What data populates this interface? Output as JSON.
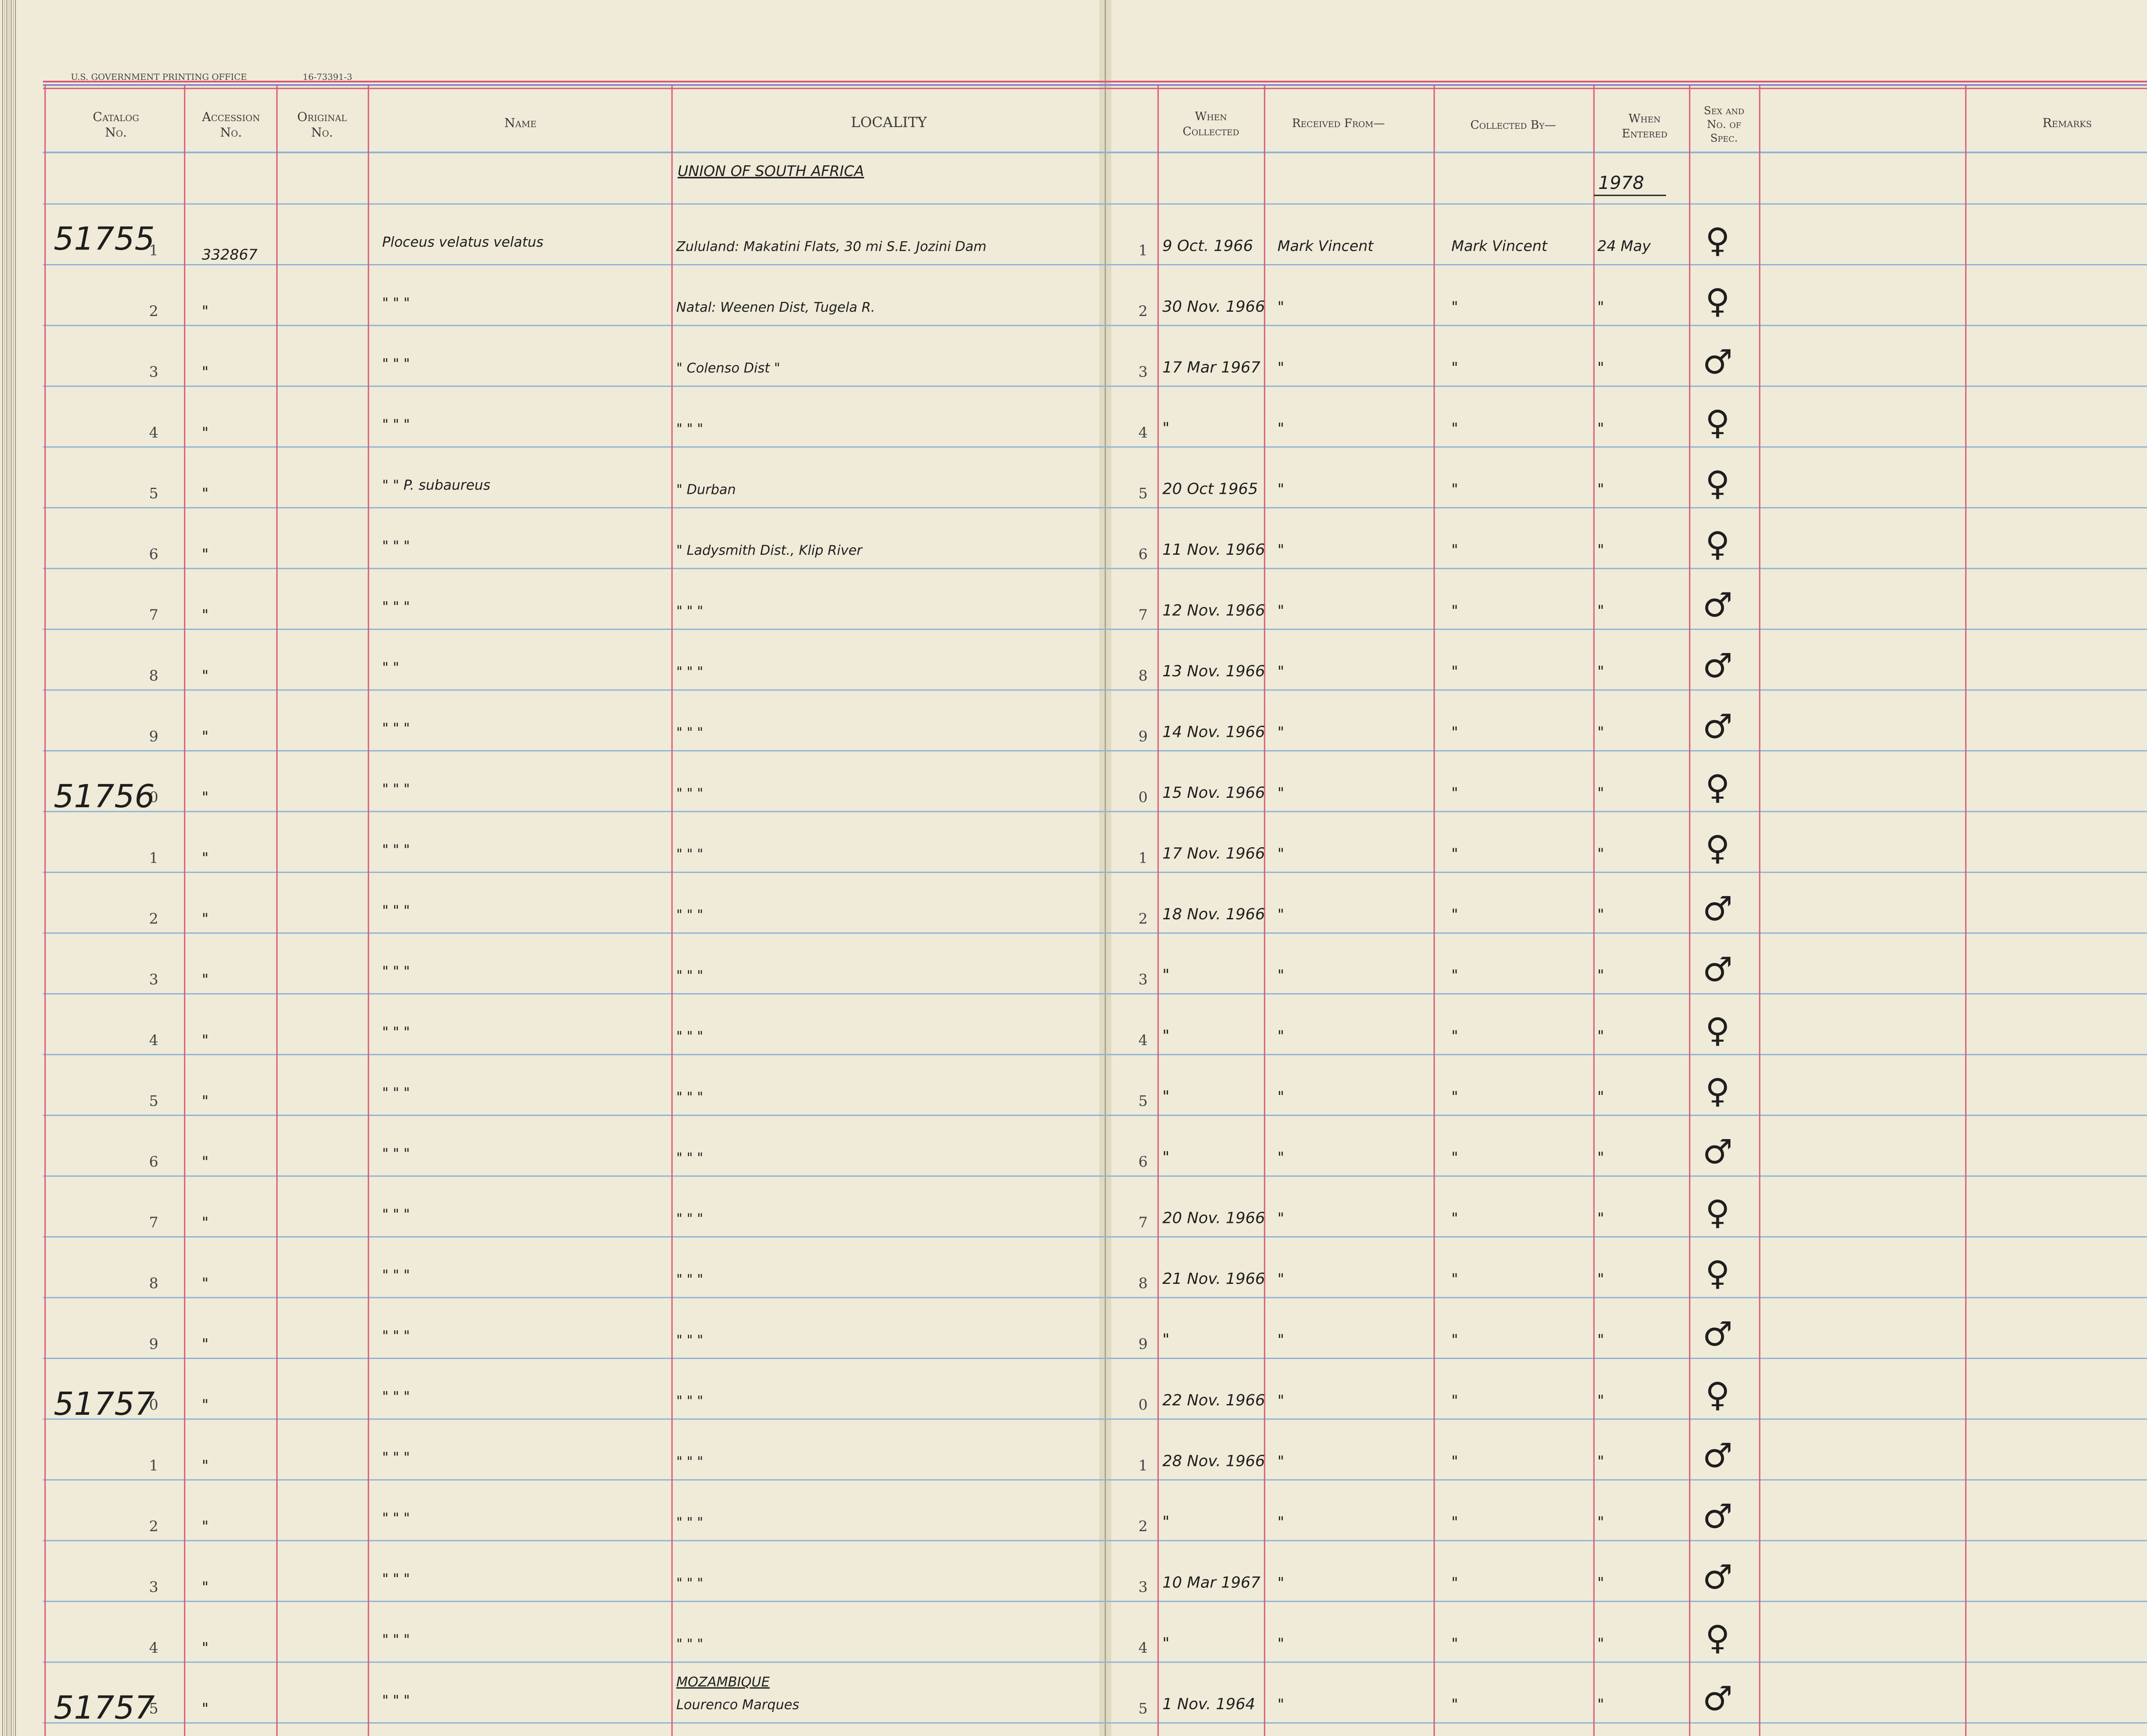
{
  "printer_line": [
    "U.S. GOVERNMENT PRINTING OFFICE",
    "16-73391-3"
  ],
  "headers": {
    "catalog": [
      "Catalog",
      "No."
    ],
    "accession": [
      "Accession",
      "No."
    ],
    "original": [
      "Original",
      "No."
    ],
    "name": "Name",
    "locality": "LOCALITY",
    "when_collected": [
      "When",
      "Collected"
    ],
    "received_from": "Received From—",
    "collected_by": "Collected By—",
    "when_entered": [
      "When",
      "Entered"
    ],
    "sex": [
      "Sex and",
      "No. of",
      "Spec."
    ],
    "remarks": "Remarks"
  },
  "header_notes": {
    "locality_region": "UNION OF SOUTH AFRICA",
    "entered_year": "1978"
  },
  "rows": [
    {
      "row": "1",
      "catalog": "51755",
      "accession": "332867",
      "name": "Ploceus velatus velatus",
      "locality": "Zululand: Makatini Flats, 30 mi S.E. Jozini Dam",
      "collected": "9 Oct. 1966",
      "received": "Mark Vincent",
      "collector": "Mark Vincent",
      "entered": "24 May",
      "sex": "♀"
    },
    {
      "row": "2",
      "accession": "\"",
      "name": "\"   \"   \"",
      "locality": "Natal: Weenen Dist, Tugela R.",
      "collected": "30 Nov. 1966",
      "received": "\"",
      "collector": "\"",
      "entered": "\"",
      "sex": "♀"
    },
    {
      "row": "3",
      "accession": "\"",
      "name": "\"   \"   \"",
      "locality": "\"   Colenso Dist   \"",
      "collected": "17 Mar 1967",
      "received": "\"",
      "collector": "\"",
      "entered": "\"",
      "sex": "♂"
    },
    {
      "row": "4",
      "accession": "\"",
      "name": "\"   \"   \"",
      "locality": "\"   \"   \"",
      "collected": "\"",
      "received": "\"",
      "collector": "\"",
      "entered": "\"",
      "sex": "♀"
    },
    {
      "row": "5",
      "accession": "\"",
      "name": "\"   \" P. subaureus",
      "locality": "\"   Durban",
      "collected": "20 Oct 1965",
      "received": "\"",
      "collector": "\"",
      "entered": "\"",
      "sex": "♀"
    },
    {
      "row": "6",
      "accession": "\"",
      "name": "\"   \"   \"",
      "locality": "\"   Ladysmith Dist., Klip River",
      "collected": "11 Nov. 1966",
      "received": "\"",
      "collector": "\"",
      "entered": "\"",
      "sex": "♀"
    },
    {
      "row": "7",
      "accession": "\"",
      "name": "\"   \"   \"",
      "locality": "\"   \"   \"",
      "collected": "12 Nov. 1966",
      "received": "\"",
      "collector": "\"",
      "entered": "\"",
      "sex": "♂"
    },
    {
      "row": "8",
      "accession": "\"",
      "name": "\"   \"",
      "locality": "\"   \"   \"",
      "collected": "13 Nov. 1966",
      "received": "\"",
      "collector": "\"",
      "entered": "\"",
      "sex": "♂"
    },
    {
      "row": "9",
      "accession": "\"",
      "name": "\"   \"   \"",
      "locality": "\"   \"   \"",
      "collected": "14 Nov. 1966",
      "received": "\"",
      "collector": "\"",
      "entered": "\"",
      "sex": "♂"
    },
    {
      "row": "0",
      "catalog": "51756",
      "accession": "\"",
      "name": "\"   \"   \"",
      "locality": "\"   \"   \"",
      "collected": "15 Nov. 1966",
      "received": "\"",
      "collector": "\"",
      "entered": "\"",
      "sex": "♀"
    },
    {
      "row": "1",
      "accession": "\"",
      "name": "\"   \"   \"",
      "locality": "\"   \"   \"",
      "collected": "17 Nov. 1966",
      "received": "\"",
      "collector": "\"",
      "entered": "\"",
      "sex": "♀"
    },
    {
      "row": "2",
      "accession": "\"",
      "name": "\"   \"   \"",
      "locality": "\"   \"   \"",
      "collected": "18 Nov. 1966",
      "received": "\"",
      "collector": "\"",
      "entered": "\"",
      "sex": "♂"
    },
    {
      "row": "3",
      "accession": "\"",
      "name": "\"   \"   \"",
      "locality": "\"   \"   \"",
      "collected": "\"",
      "received": "\"",
      "collector": "\"",
      "entered": "\"",
      "sex": "♂"
    },
    {
      "row": "4",
      "accession": "\"",
      "name": "\"   \"   \"",
      "locality": "\"   \"   \"",
      "collected": "\"",
      "received": "\"",
      "collector": "\"",
      "entered": "\"",
      "sex": "♀"
    },
    {
      "row": "5",
      "accession": "\"",
      "name": "\"   \"   \"",
      "locality": "\"   \"   \"",
      "collected": "\"",
      "received": "\"",
      "collector": "\"",
      "entered": "\"",
      "sex": "♀"
    },
    {
      "row": "6",
      "accession": "\"",
      "name": "\"   \"   \"",
      "locality": "\"   \"   \"",
      "collected": "\"",
      "received": "\"",
      "collector": "\"",
      "entered": "\"",
      "sex": "♂"
    },
    {
      "row": "7",
      "accession": "\"",
      "name": "\"   \"   \"",
      "locality": "\"   \"   \"",
      "collected": "20 Nov. 1966",
      "received": "\"",
      "collector": "\"",
      "entered": "\"",
      "sex": "♀"
    },
    {
      "row": "8",
      "accession": "\"",
      "name": "\"   \"   \"",
      "locality": "\"   \"   \"",
      "collected": "21 Nov. 1966",
      "received": "\"",
      "collector": "\"",
      "entered": "\"",
      "sex": "♀"
    },
    {
      "row": "9",
      "accession": "\"",
      "name": "\"   \"   \"",
      "locality": "\"   \"   \"",
      "collected": "\"",
      "received": "\"",
      "collector": "\"",
      "entered": "\"",
      "sex": "♂"
    },
    {
      "row": "0",
      "catalog": "51757",
      "accession": "\"",
      "name": "\"   \"   \"",
      "locality": "\"   \"   \"",
      "collected": "22 Nov. 1966",
      "received": "\"",
      "collector": "\"",
      "entered": "\"",
      "sex": "♀"
    },
    {
      "row": "1",
      "accession": "\"",
      "name": "\"   \"   \"",
      "locality": "\"   \"   \"",
      "collected": "28 Nov. 1966",
      "received": "\"",
      "collector": "\"",
      "entered": "\"",
      "sex": "♂"
    },
    {
      "row": "2",
      "accession": "\"",
      "name": "\"   \"   \"",
      "locality": "\"   \"   \"",
      "collected": "\"",
      "received": "\"",
      "collector": "\"",
      "entered": "\"",
      "sex": "♂"
    },
    {
      "row": "3",
      "accession": "\"",
      "name": "\"   \"   \"",
      "locality": "\"   \"   \"",
      "collected": "10 Mar 1967",
      "received": "\"",
      "collector": "\"",
      "entered": "\"",
      "sex": "♂"
    },
    {
      "row": "4",
      "accession": "\"",
      "name": "\"   \"   \"",
      "locality": "\"   \"   \"",
      "collected": "\"",
      "received": "\"",
      "collector": "\"",
      "entered": "\"",
      "sex": "♀"
    },
    {
      "row": "5",
      "catalog": "51757",
      "accession": "\"",
      "name": "\"   \"   \"",
      "locality_region": "MOZAMBIQUE",
      "locality": "Lourenco Marques",
      "collected": "1 Nov. 1964",
      "received": "\"",
      "collector": "\"",
      "entered": "\"",
      "sex": "♂"
    }
  ],
  "colors": {
    "paper": "#efebd8",
    "blue_rule": "#8fb3d3",
    "red_rule": "#d9577a",
    "ink": "#1e1e1e"
  }
}
